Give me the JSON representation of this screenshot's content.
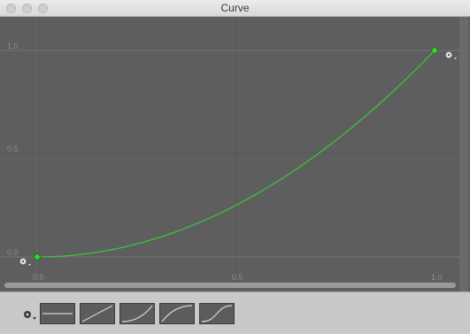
{
  "window": {
    "title": "Curve"
  },
  "graph": {
    "y_labels": [
      "1.0",
      "0.5",
      "0.0"
    ],
    "x_labels": [
      "0.0",
      "0.5",
      "1.0"
    ],
    "curve_color": "#3cc23c",
    "key_color": "#35d335"
  },
  "toolbar": {
    "settings_icon": "gear-icon",
    "presets": [
      "flat",
      "linear",
      "ease-in",
      "ease-out",
      "ease-in-out"
    ]
  }
}
